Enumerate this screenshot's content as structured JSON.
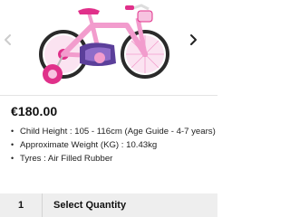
{
  "product": {
    "image_alt": "Girls pink bicycle with stabilisers",
    "price": "€180.00",
    "specs": [
      "Child Height : 105 - 116cm (Age Guide - 4-7 years)",
      "Approximate Weight (KG) : 10.43kg",
      "Tyres : Air Filled Rubber"
    ]
  },
  "gallery": {
    "prev_icon": "chevron-left-icon",
    "next_icon": "chevron-right-icon"
  },
  "quantity": {
    "value": "1",
    "label": "Select Quantity"
  },
  "colors": {
    "bike_pink": "#f29ccd",
    "bike_magenta": "#e0308a",
    "tyre": "#2a2a2a",
    "chevron_light": "#cccccc",
    "chevron_dark": "#222222",
    "quantity_bar": "#eeeeee"
  }
}
